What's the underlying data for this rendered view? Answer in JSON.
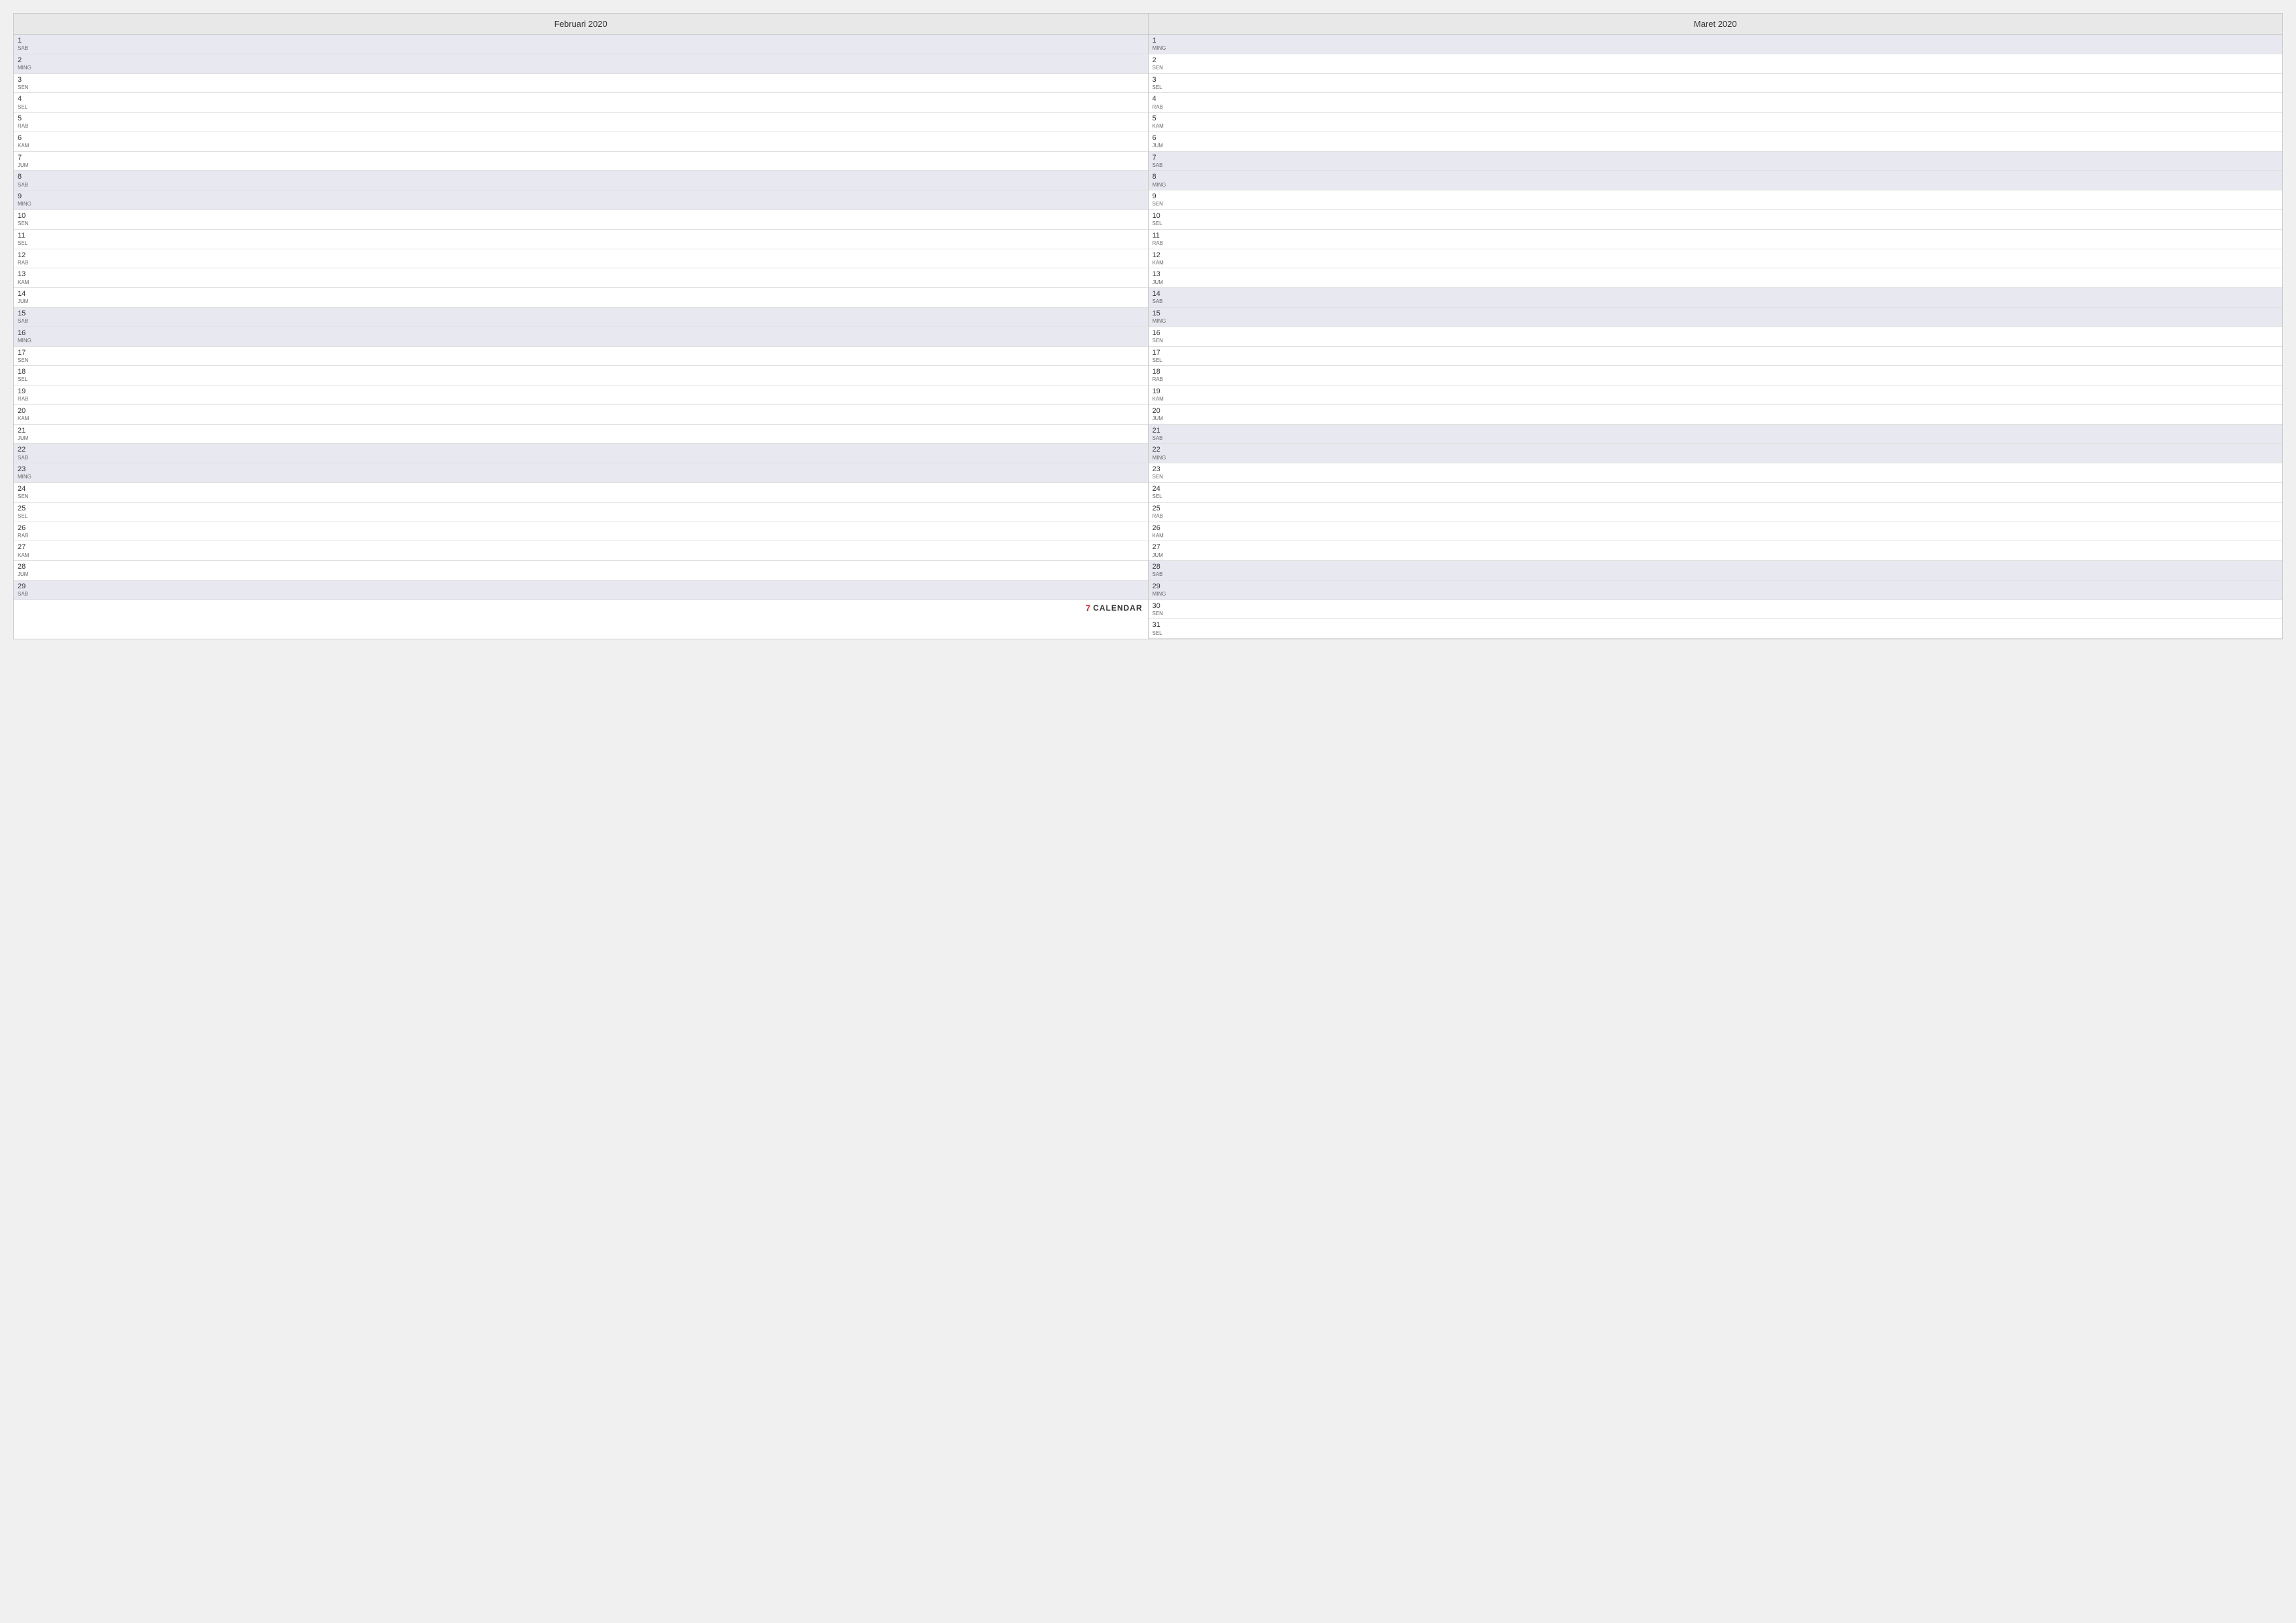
{
  "february": {
    "title": "Februari 2020",
    "days": [
      {
        "num": "1",
        "name": "SAB",
        "weekend": true
      },
      {
        "num": "2",
        "name": "MING",
        "weekend": true
      },
      {
        "num": "3",
        "name": "SEN",
        "weekend": false
      },
      {
        "num": "4",
        "name": "SEL",
        "weekend": false
      },
      {
        "num": "5",
        "name": "RAB",
        "weekend": false
      },
      {
        "num": "6",
        "name": "KAM",
        "weekend": false
      },
      {
        "num": "7",
        "name": "JUM",
        "weekend": false
      },
      {
        "num": "8",
        "name": "SAB",
        "weekend": true
      },
      {
        "num": "9",
        "name": "MING",
        "weekend": true
      },
      {
        "num": "10",
        "name": "SEN",
        "weekend": false
      },
      {
        "num": "11",
        "name": "SEL",
        "weekend": false
      },
      {
        "num": "12",
        "name": "RAB",
        "weekend": false
      },
      {
        "num": "13",
        "name": "KAM",
        "weekend": false
      },
      {
        "num": "14",
        "name": "JUM",
        "weekend": false
      },
      {
        "num": "15",
        "name": "SAB",
        "weekend": true
      },
      {
        "num": "16",
        "name": "MING",
        "weekend": true
      },
      {
        "num": "17",
        "name": "SEN",
        "weekend": false
      },
      {
        "num": "18",
        "name": "SEL",
        "weekend": false
      },
      {
        "num": "19",
        "name": "RAB",
        "weekend": false
      },
      {
        "num": "20",
        "name": "KAM",
        "weekend": false
      },
      {
        "num": "21",
        "name": "JUM",
        "weekend": false
      },
      {
        "num": "22",
        "name": "SAB",
        "weekend": true
      },
      {
        "num": "23",
        "name": "MING",
        "weekend": true
      },
      {
        "num": "24",
        "name": "SEN",
        "weekend": false
      },
      {
        "num": "25",
        "name": "SEL",
        "weekend": false
      },
      {
        "num": "26",
        "name": "RAB",
        "weekend": false
      },
      {
        "num": "27",
        "name": "KAM",
        "weekend": false
      },
      {
        "num": "28",
        "name": "JUM",
        "weekend": false
      },
      {
        "num": "29",
        "name": "SAB",
        "weekend": true
      }
    ]
  },
  "march": {
    "title": "Maret 2020",
    "days": [
      {
        "num": "1",
        "name": "MING",
        "weekend": true
      },
      {
        "num": "2",
        "name": "SEN",
        "weekend": false
      },
      {
        "num": "3",
        "name": "SEL",
        "weekend": false
      },
      {
        "num": "4",
        "name": "RAB",
        "weekend": false
      },
      {
        "num": "5",
        "name": "KAM",
        "weekend": false
      },
      {
        "num": "6",
        "name": "JUM",
        "weekend": false
      },
      {
        "num": "7",
        "name": "SAB",
        "weekend": true
      },
      {
        "num": "8",
        "name": "MING",
        "weekend": true
      },
      {
        "num": "9",
        "name": "SEN",
        "weekend": false
      },
      {
        "num": "10",
        "name": "SEL",
        "weekend": false
      },
      {
        "num": "11",
        "name": "RAB",
        "weekend": false
      },
      {
        "num": "12",
        "name": "KAM",
        "weekend": false
      },
      {
        "num": "13",
        "name": "JUM",
        "weekend": false
      },
      {
        "num": "14",
        "name": "SAB",
        "weekend": true
      },
      {
        "num": "15",
        "name": "MING",
        "weekend": true
      },
      {
        "num": "16",
        "name": "SEN",
        "weekend": false
      },
      {
        "num": "17",
        "name": "SEL",
        "weekend": false
      },
      {
        "num": "18",
        "name": "RAB",
        "weekend": false
      },
      {
        "num": "19",
        "name": "KAM",
        "weekend": false
      },
      {
        "num": "20",
        "name": "JUM",
        "weekend": false
      },
      {
        "num": "21",
        "name": "SAB",
        "weekend": true
      },
      {
        "num": "22",
        "name": "MING",
        "weekend": true
      },
      {
        "num": "23",
        "name": "SEN",
        "weekend": false
      },
      {
        "num": "24",
        "name": "SEL",
        "weekend": false
      },
      {
        "num": "25",
        "name": "RAB",
        "weekend": false
      },
      {
        "num": "26",
        "name": "KAM",
        "weekend": false
      },
      {
        "num": "27",
        "name": "JUM",
        "weekend": false
      },
      {
        "num": "28",
        "name": "SAB",
        "weekend": true
      },
      {
        "num": "29",
        "name": "MING",
        "weekend": true
      },
      {
        "num": "30",
        "name": "SEN",
        "weekend": false
      },
      {
        "num": "31",
        "name": "SEL",
        "weekend": false
      }
    ]
  },
  "branding": {
    "icon": "7",
    "label": "CALENDAR"
  }
}
